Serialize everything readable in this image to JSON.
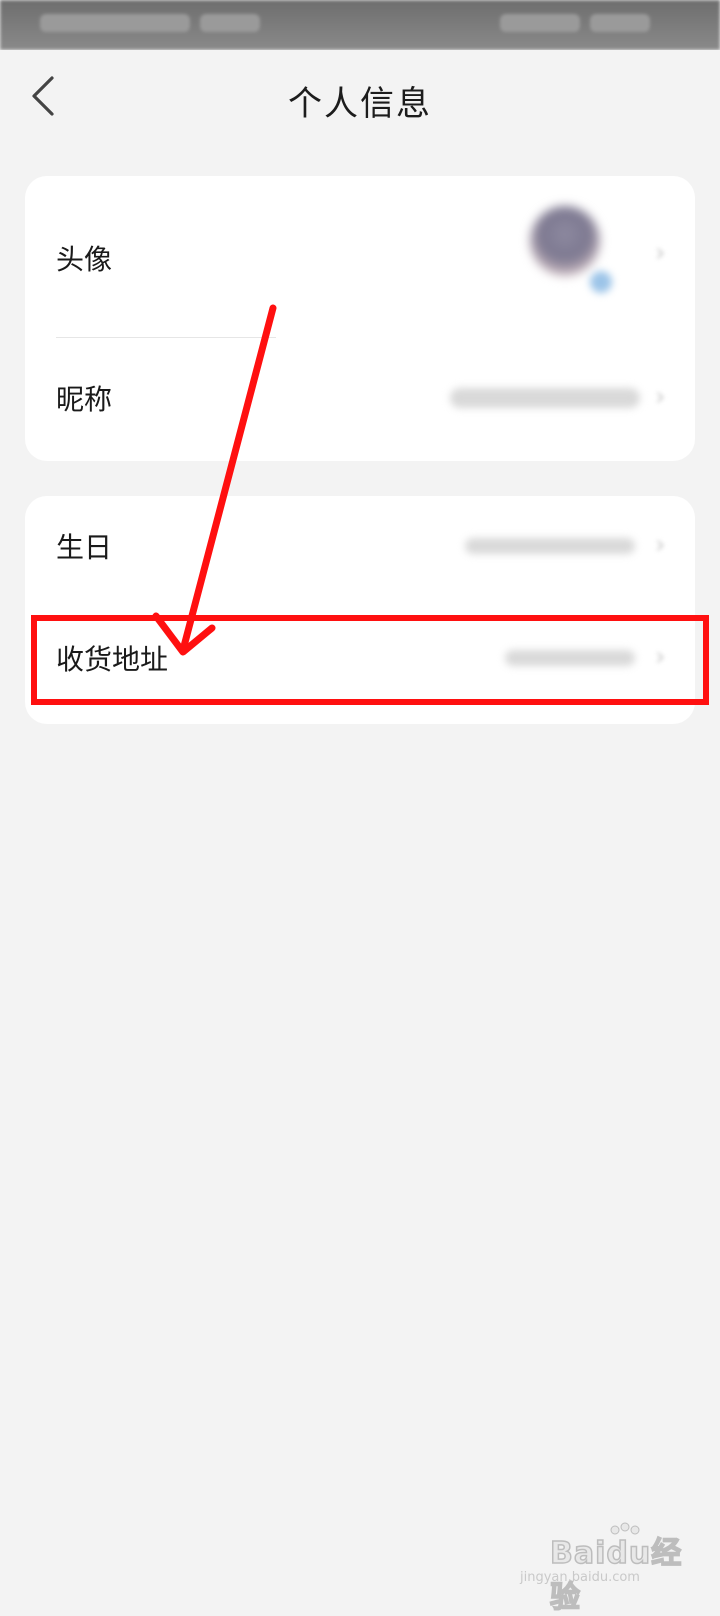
{
  "nav": {
    "title": "个人信息",
    "back_icon": "chevron-left-icon"
  },
  "profile_card": {
    "rows": [
      {
        "label": "头像",
        "value_type": "avatar-image"
      },
      {
        "label": "昵称",
        "value_type": "blurred-text"
      }
    ]
  },
  "details_card": {
    "rows": [
      {
        "label": "生日",
        "value_type": "blurred-text"
      },
      {
        "label": "收货地址",
        "value_type": "blurred-text"
      }
    ]
  },
  "annotation": {
    "highlight_target": "收货地址",
    "color": "#ff1010"
  },
  "watermark": {
    "logo_text": "Baidu经验",
    "url": "jingyan.baidu.com"
  },
  "colors": {
    "background": "#f3f3f3",
    "card": "#ffffff",
    "annotation": "#ff1010"
  }
}
